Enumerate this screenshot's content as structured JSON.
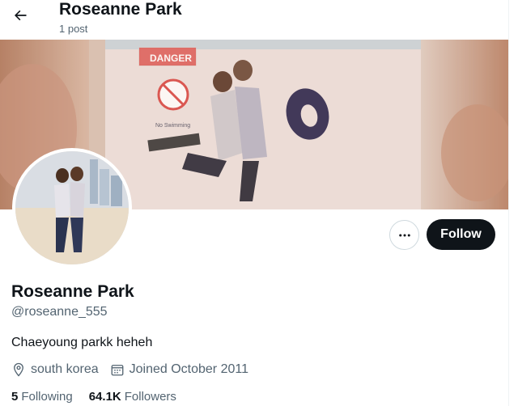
{
  "header": {
    "title": "Roseanne Park",
    "post_count": "1 post"
  },
  "banner": {
    "sign_text": "DANGER",
    "sign_subtext": "No Swimming"
  },
  "profile": {
    "display_name": "Roseanne Park",
    "handle": "@roseanne_555",
    "bio": "Chaeyoung parkk heheh",
    "location": "south korea",
    "joined": "Joined October 2011",
    "following_count": "5",
    "following_label": "Following",
    "followers_count": "64.1K",
    "followers_label": "Followers"
  },
  "actions": {
    "follow_label": "Follow",
    "more_icon": "more-horizontal-icon"
  },
  "icons": {
    "back": "arrow-left-icon",
    "location": "location-pin-icon",
    "calendar": "calendar-icon"
  },
  "colors": {
    "primary_text": "#0f1419",
    "secondary_text": "#536471",
    "follow_bg": "#0f1419",
    "border": "#cfd9de"
  }
}
